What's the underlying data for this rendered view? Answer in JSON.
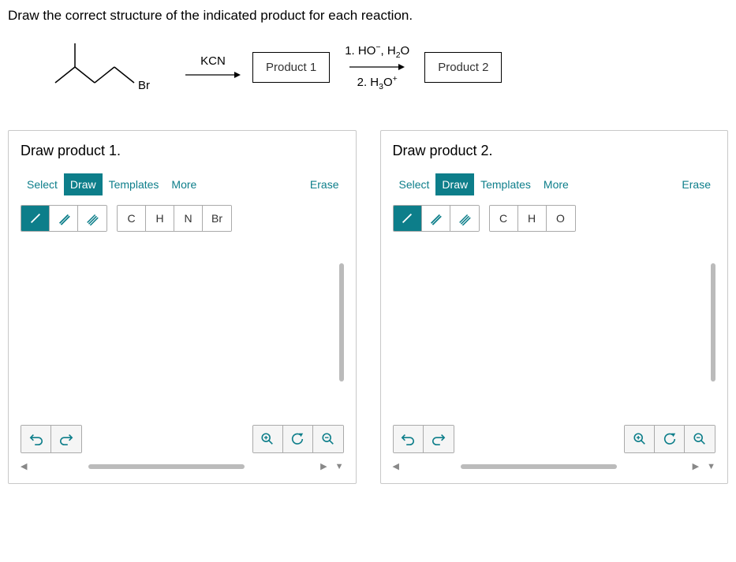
{
  "instruction": "Draw the correct structure of the indicated product for each reaction.",
  "reaction": {
    "start_label_br": "Br",
    "reagent1": "KCN",
    "product1_label": "Product 1",
    "step2_line1_prefix": "1. HO",
    "step2_line1_super": "−",
    "step2_line1_mid": ", H",
    "step2_line1_sub": "2",
    "step2_line1_suffix": "O",
    "step2_line2_prefix": "2. H",
    "step2_line2_sub": "3",
    "step2_line2_mid": "O",
    "step2_line2_super": "+",
    "product2_label": "Product 2"
  },
  "tabs": {
    "select": "Select",
    "draw": "Draw",
    "templates": "Templates",
    "more": "More",
    "erase": "Erase"
  },
  "panel1": {
    "title": "Draw product 1.",
    "elements": {
      "c": "C",
      "h": "H",
      "n": "N",
      "br": "Br"
    }
  },
  "panel2": {
    "title": "Draw product 2.",
    "elements": {
      "c": "C",
      "h": "H",
      "o": "O"
    }
  }
}
